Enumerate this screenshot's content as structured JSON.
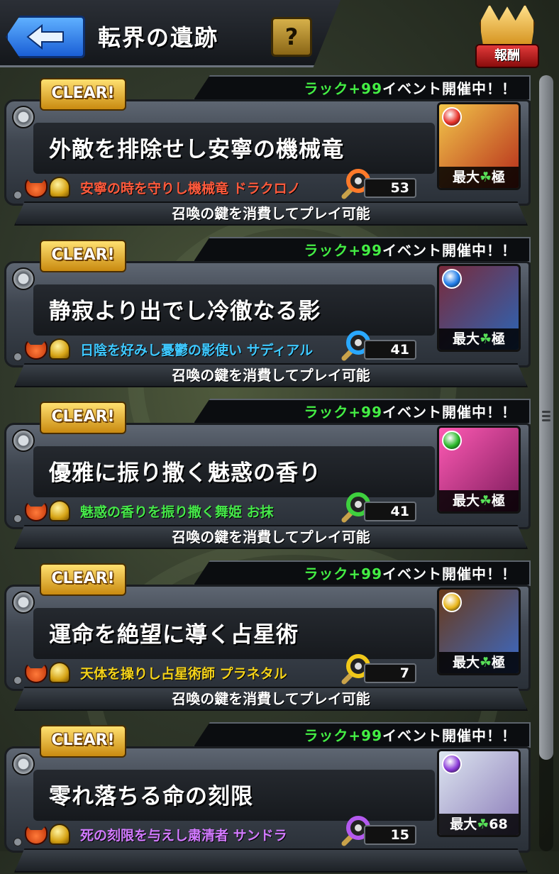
{
  "header": {
    "title": "転界の遺跡",
    "help_label": "?",
    "reward_label": "報酬"
  },
  "quests": [
    {
      "clear_label": "CLEAR!",
      "event_prefix": "ラック+99",
      "event_suffix": "イベント開催中！！",
      "title": "外敵を排除せし安寧の機械竜",
      "boss_name": "安寧の時を守りし機械竜 ドラクロノ",
      "boss_color": "#ff5a3c",
      "key_color": "#ff7a2a",
      "key_count": "53",
      "element_color": "#e8322a",
      "portrait_colors": [
        "#f2c64a",
        "#b52a1a"
      ],
      "luck_prefix": "最大",
      "luck_clover": "☘",
      "luck_value": "極",
      "summon_text": "召喚の鍵を消費してプレイ可能"
    },
    {
      "clear_label": "CLEAR!",
      "event_prefix": "ラック+99",
      "event_suffix": "イベント開催中！！",
      "title": "静寂より出でし冷徹なる影",
      "boss_name": "日陰を好みし憂鬱の影使い サディアル",
      "boss_color": "#3ec8ff",
      "key_color": "#2aa8ff",
      "key_count": "41",
      "element_color": "#1e7ce8",
      "portrait_colors": [
        "#7a2a3a",
        "#2a66b8"
      ],
      "luck_prefix": "最大",
      "luck_clover": "☘",
      "luck_value": "極",
      "summon_text": "召喚の鍵を消費してプレイ可能"
    },
    {
      "clear_label": "CLEAR!",
      "event_prefix": "ラック+99",
      "event_suffix": "イベント開催中！！",
      "title": "優雅に振り撒く魅惑の香り",
      "boss_name": "魅惑の香りを振り撒く舞姫 お抹",
      "boss_color": "#46e84a",
      "key_color": "#3ed03e",
      "key_count": "41",
      "element_color": "#2ab82a",
      "portrait_colors": [
        "#ff5ab4",
        "#7a1a5a"
      ],
      "luck_prefix": "最大",
      "luck_clover": "☘",
      "luck_value": "極",
      "summon_text": "召喚の鍵を消費してプレイ可能"
    },
    {
      "clear_label": "CLEAR!",
      "event_prefix": "ラック+99",
      "event_suffix": "イベント開催中！！",
      "title": "運命を絶望に導く占星術",
      "boss_name": "天体を操りし占星術師 プラネタル",
      "boss_color": "#f4d21a",
      "key_color": "#f0c81a",
      "key_count": "7",
      "element_color": "#e8b418",
      "portrait_colors": [
        "#6a3a1a",
        "#3a6ac8"
      ],
      "luck_prefix": "最大",
      "luck_clover": "☘",
      "luck_value": "極",
      "summon_text": "召喚の鍵を消費してプレイ可能"
    },
    {
      "clear_label": "CLEAR!",
      "event_prefix": "ラック+99",
      "event_suffix": "イベント開催中！！",
      "title": "零れ落ちる命の刻限",
      "boss_name": "死の刻限を与えし粛清者 サンドラ",
      "boss_color": "#d27aff",
      "key_color": "#b45aef",
      "key_count": "15",
      "element_color": "#8a3ad8",
      "portrait_colors": [
        "#dde6f0",
        "#8a7ab8"
      ],
      "luck_prefix": "最大",
      "luck_clover": "☘",
      "luck_value": "68",
      "summon_text": ""
    }
  ]
}
